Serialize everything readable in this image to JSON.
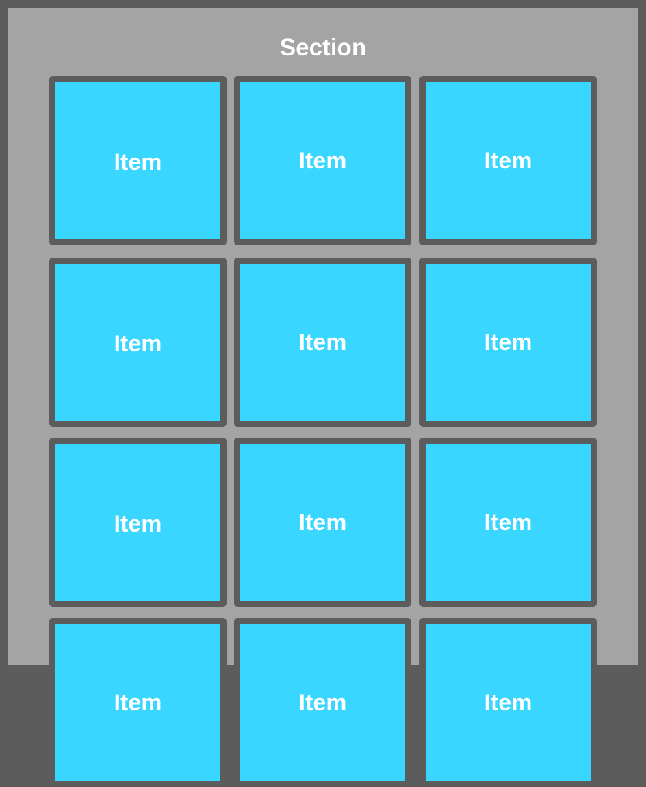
{
  "section": {
    "title": "Section"
  },
  "colors": {
    "background": "#5c5c5c",
    "section_background": "#a4a4a4",
    "item_background": "#39d6ff",
    "item_border": "#5c5c5c",
    "text": "#ffffff"
  },
  "items": [
    {
      "label": "Item"
    },
    {
      "label": "Item"
    },
    {
      "label": "Item"
    },
    {
      "label": "Item"
    },
    {
      "label": "Item"
    },
    {
      "label": "Item"
    },
    {
      "label": "Item"
    },
    {
      "label": "Item"
    },
    {
      "label": "Item"
    },
    {
      "label": "Item"
    },
    {
      "label": "Item"
    },
    {
      "label": "Item"
    }
  ]
}
